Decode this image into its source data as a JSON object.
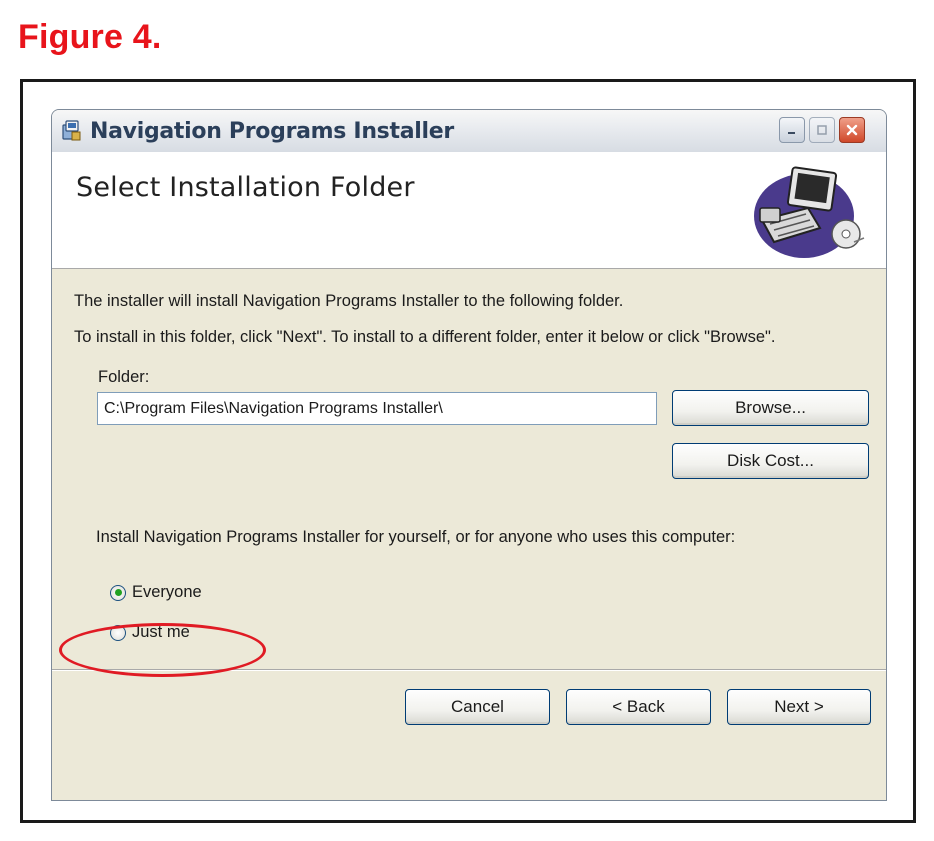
{
  "figure_caption": "Figure 4.",
  "window": {
    "title": "Navigation Programs Installer",
    "app_icon": "installer-icon",
    "controls": {
      "minimize": "minimize-icon",
      "maximize": "maximize-icon",
      "close": "close-icon"
    }
  },
  "header": {
    "title": "Select Installation Folder",
    "illustration": "computer-disk-icon"
  },
  "body": {
    "intro_line_1": "The installer will install Navigation Programs Installer to the following folder.",
    "intro_line_2": "To install in this folder, click \"Next\". To install to a different folder, enter it below or click \"Browse\".",
    "folder_label": "Folder:",
    "folder_value": "C:\\Program Files\\Navigation Programs Installer\\",
    "browse_label": "Browse...",
    "disk_cost_label": "Disk Cost...",
    "install_for_prompt": "Install Navigation Programs Installer for yourself, or for anyone who uses this computer:",
    "radio_options": [
      {
        "label": "Everyone",
        "selected": true
      },
      {
        "label": "Just me",
        "selected": false
      }
    ]
  },
  "footer": {
    "cancel_label": "Cancel",
    "back_label": "< Back",
    "next_label": "Next >"
  },
  "colors": {
    "caption": "#e8141b",
    "highlight_ellipse": "#e01b24",
    "dialog_background": "#ece9d8",
    "radio_dot": "#21a121"
  }
}
